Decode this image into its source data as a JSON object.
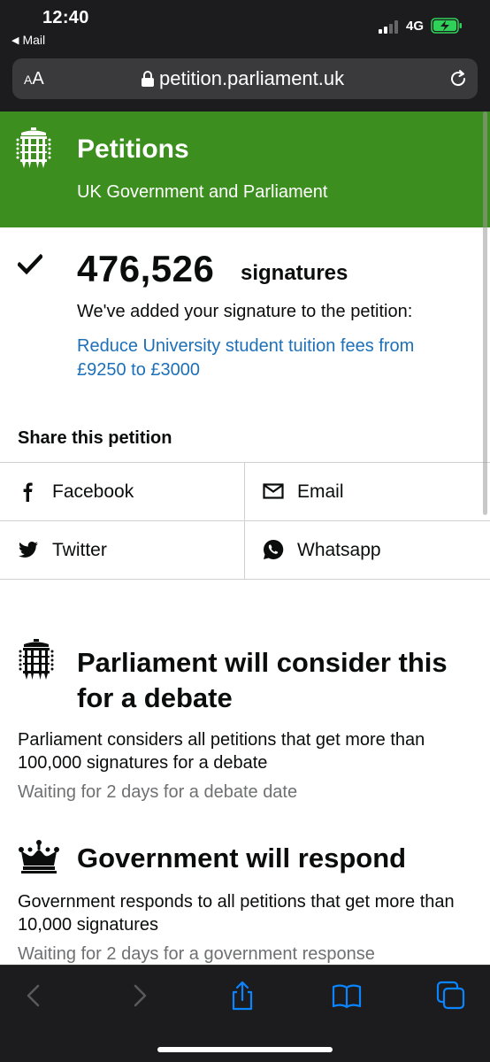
{
  "status_bar": {
    "time": "12:40",
    "back_app": "Mail",
    "network": "4G",
    "battery_color": "#30d158"
  },
  "browser": {
    "text_size_button": "AA",
    "url": "petition.parliament.uk"
  },
  "header": {
    "title": "Petitions",
    "subtitle": "UK Government and Parliament",
    "brand_color": "#3c8f1f"
  },
  "signatures": {
    "count": "476,526",
    "label": "signatures",
    "confirmation": "We've added your signature to the petition:",
    "petition_title": "Reduce University student tuition fees from £9250 to £3000"
  },
  "share": {
    "title": "Share this petition",
    "options": [
      {
        "label": "Facebook",
        "icon": "facebook-icon"
      },
      {
        "label": "Email",
        "icon": "email-icon"
      },
      {
        "label": "Twitter",
        "icon": "twitter-icon"
      },
      {
        "label": "Whatsapp",
        "icon": "whatsapp-icon"
      }
    ]
  },
  "thresholds": [
    {
      "icon": "portcullis-icon",
      "title": "Parliament will consider this for a debate",
      "body": "Parliament considers all petitions that get more than 100,000 signatures for a debate",
      "status": "Waiting for 2 days for a debate date"
    },
    {
      "icon": "crown-icon",
      "title": "Government will respond",
      "body": "Government responds to all petitions that get more than 10,000 signatures",
      "status": "Waiting for 2 days for a government response"
    }
  ],
  "toolbar": {
    "icons": [
      "back-icon",
      "forward-icon",
      "share-icon",
      "bookmarks-icon",
      "tabs-icon"
    ],
    "accent": "#0a84ff"
  }
}
